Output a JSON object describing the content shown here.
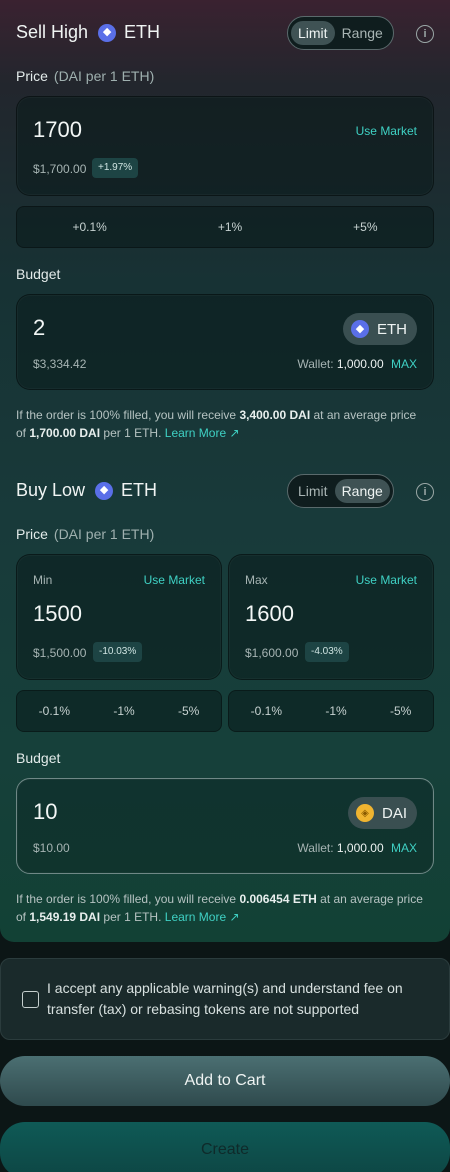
{
  "sell": {
    "title": "Sell High",
    "token": "ETH",
    "toggle": {
      "limit": "Limit",
      "range": "Range",
      "active": "Limit"
    },
    "price_label": "Price",
    "price_unit": "(DAI per 1 ETH)",
    "price_value": "1700",
    "use_market": "Use Market",
    "price_usd": "$1,700.00",
    "price_change": "+1.97%",
    "pct_options": [
      "+0.1%",
      "+1%",
      "+5%"
    ],
    "budget_label": "Budget",
    "budget_value": "2",
    "budget_token": "ETH",
    "budget_usd": "$3,334.42",
    "wallet_label": "Wallet:",
    "wallet_value": "1,000.00",
    "max_label": "MAX",
    "note_pre": "If the order is 100% filled, you will receive ",
    "note_amount": "3,400.00 DAI",
    "note_mid": " at an average price of ",
    "note_price": "1,700.00 DAI",
    "note_post": " per 1 ETH.",
    "learn_more": "Learn More"
  },
  "buy": {
    "title": "Buy Low",
    "token": "ETH",
    "toggle": {
      "limit": "Limit",
      "range": "Range",
      "active": "Range"
    },
    "price_label": "Price",
    "price_unit": "(DAI per 1 ETH)",
    "min": {
      "label": "Min",
      "use_market": "Use Market",
      "value": "1500",
      "usd": "$1,500.00",
      "change": "-10.03%"
    },
    "max": {
      "label": "Max",
      "use_market": "Use Market",
      "value": "1600",
      "usd": "$1,600.00",
      "change": "-4.03%"
    },
    "pct_options": [
      "-0.1%",
      "-1%",
      "-5%"
    ],
    "budget_label": "Budget",
    "budget_value": "10",
    "budget_token": "DAI",
    "budget_usd": "$10.00",
    "wallet_label": "Wallet:",
    "wallet_value": "1,000.00",
    "max_label": "MAX",
    "note_pre": "If the order is 100% filled, you will receive ",
    "note_amount": "0.006454 ETH",
    "note_mid": " at an average price of ",
    "note_price": "1,549.19 DAI",
    "note_post": " per 1 ETH.",
    "learn_more": "Learn More"
  },
  "accept_text": "I accept any applicable warning(s) and understand fee on transfer (tax) or rebasing tokens are not supported",
  "add_to_cart": "Add to Cart",
  "create": "Create",
  "colors": {
    "accent": "#3fd1c4",
    "eth": "#5a6fe8",
    "dai": "#f0b430"
  }
}
